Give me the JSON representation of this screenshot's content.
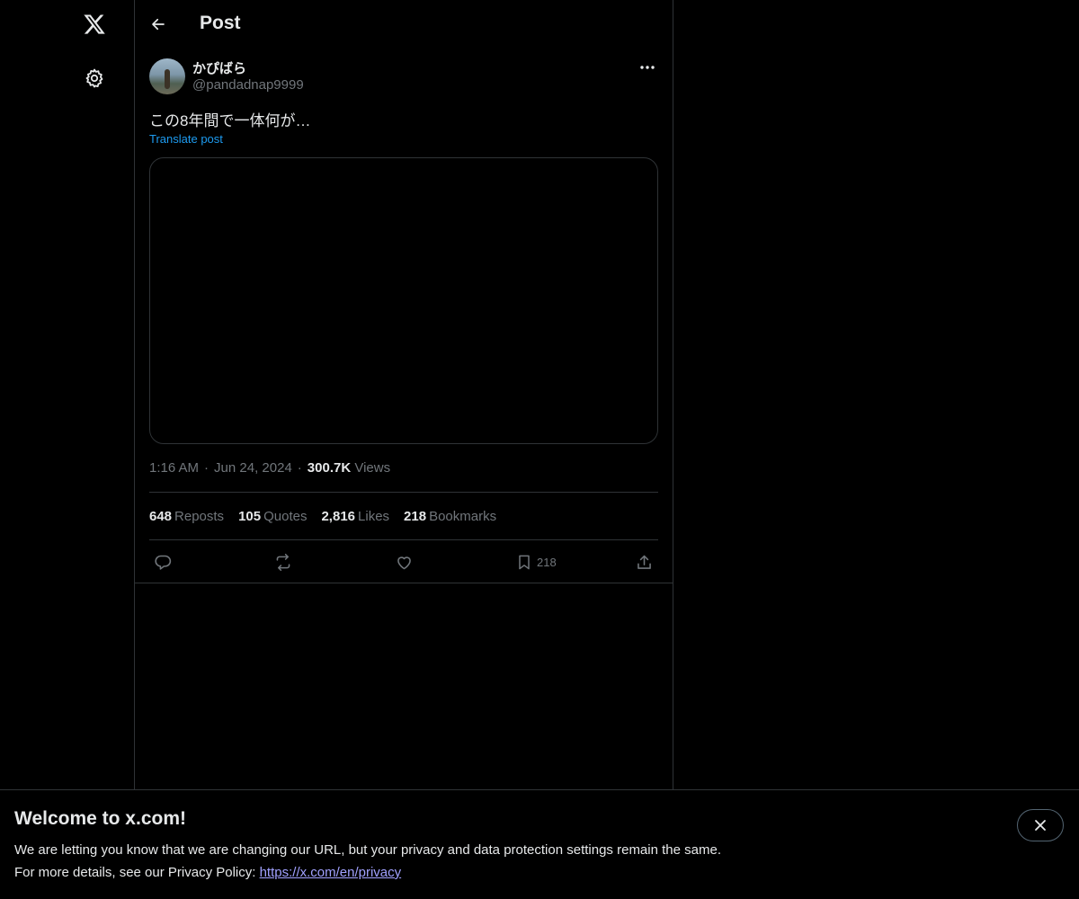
{
  "header": {
    "title": "Post"
  },
  "post": {
    "author_name": "かぴばら",
    "author_handle": "@pandadnap9999",
    "text": "この8年間で一体何が…",
    "translate_label": "Translate post",
    "time": "1:16 AM",
    "date": "Jun 24, 2024",
    "views_count": "300.7K",
    "views_label": "Views",
    "dot": "·"
  },
  "stats": [
    {
      "num": "648",
      "label": "Reposts"
    },
    {
      "num": "105",
      "label": "Quotes"
    },
    {
      "num": "2,816",
      "label": "Likes"
    },
    {
      "num": "218",
      "label": "Bookmarks"
    }
  ],
  "actions": {
    "bookmark_count": "218"
  },
  "banner": {
    "title": "Welcome to x.com!",
    "line1": "We are letting you know that we are changing our URL, but your privacy and data protection settings remain the same.",
    "line2_prefix": "For more details, see our Privacy Policy: ",
    "link": "https://x.com/en/privacy"
  },
  "icons": {
    "logo": "x-logo-icon",
    "settings": "gear-icon",
    "back": "back-arrow-icon",
    "more": "more-horizontal-icon",
    "reply": "reply-icon",
    "repost": "repost-icon",
    "like": "heart-icon",
    "bookmark": "bookmark-icon",
    "share": "share-icon",
    "close": "close-icon"
  },
  "colors": {
    "background": "#000000",
    "text": "#e7e9ea",
    "secondary": "#71767b",
    "link": "#1d9bf0",
    "border": "#2f3336"
  }
}
